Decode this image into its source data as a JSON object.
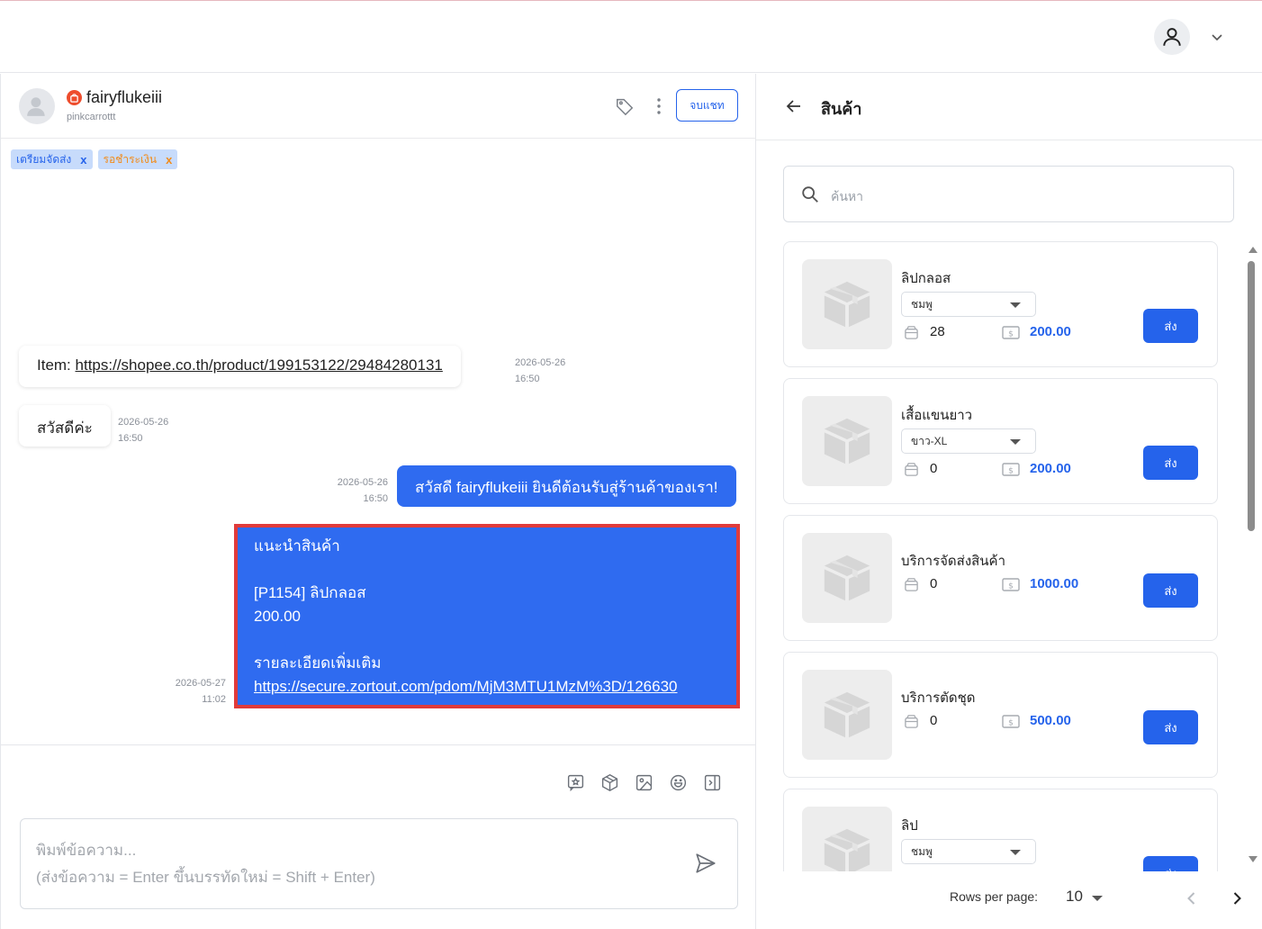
{
  "chat": {
    "customer_name": "fairyflukeiii",
    "customer_handle": "pinkcarrottt",
    "end_chat_label": "จบแชท",
    "tags": [
      {
        "label": "เตรียมจัดส่ง",
        "remove": "x",
        "color": "#2563eb"
      },
      {
        "label": "รอชำระเงิน",
        "remove": "x",
        "color": "#f28b1a"
      }
    ],
    "messages": [
      {
        "direction": "in",
        "prefix": "Item: ",
        "link": "https://shopee.co.th/product/199153122/29484280131",
        "date": "2026-05-26",
        "time": "16:50"
      },
      {
        "direction": "in",
        "text": "สวัสดีค่ะ",
        "date": "2026-05-26",
        "time": "16:50"
      },
      {
        "direction": "out",
        "text": "สวัสดี fairyflukeiii ยินดีต้อนรับสู่ร้านค้าของเรา!",
        "date": "2026-05-26",
        "time": "16:50"
      },
      {
        "direction": "out",
        "line1": "แนะนำสินค้า",
        "line2": "[P1154] ลิปกลอส",
        "line3": "200.00",
        "line4": "รายละเอียดเพิ่มเติม",
        "link": "https://secure.zortout.com/pdom/MjM3MTU1MzM%3D/126630",
        "date": "2026-05-27",
        "time": "11:02",
        "highlighted": true
      }
    ],
    "composer_placeholder": "พิมพ์ข้อความ...\n(ส่งข้อความ = Enter ขึ้นบรรทัดใหม่ = Shift + Enter)"
  },
  "panel": {
    "title": "สินค้า",
    "search_placeholder": "ค้นหา",
    "send_label": "ส่ง",
    "products": [
      {
        "name": "ลิปกลอส",
        "variant": "ชมพู",
        "stock": "28",
        "price": "200.00"
      },
      {
        "name": "เสื้อแขนยาว",
        "variant": "ขาว-XL",
        "stock": "0",
        "price": "200.00"
      },
      {
        "name": "บริการจัดส่งสินค้า",
        "variant": "",
        "stock": "0",
        "price": "1000.00"
      },
      {
        "name": "บริการตัดชุด",
        "variant": "",
        "stock": "0",
        "price": "500.00"
      },
      {
        "name": "ลิป",
        "variant": "ชมพู",
        "stock": "",
        "price": ""
      }
    ],
    "rows_per_page_label": "Rows per page:",
    "rows_per_page_value": "10"
  },
  "colors": {
    "accent": "#2563eb",
    "outgoing_bubble": "#2f6bf0",
    "highlight_border": "#e03b3b",
    "shopee_orange": "#ee4d2d"
  }
}
